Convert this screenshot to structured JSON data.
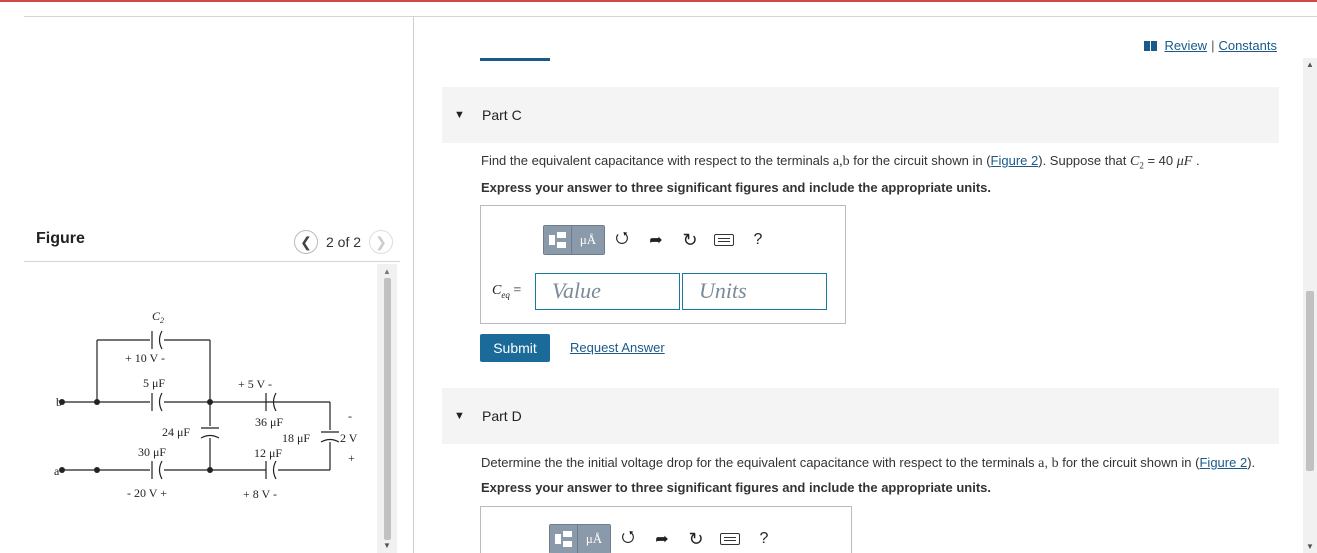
{
  "figure": {
    "title": "Figure",
    "counter": "2 of 2",
    "prev_icon": "chevron-left-icon",
    "next_icon": "chevron-right-icon",
    "circuit_labels": {
      "c2": "C",
      "c2_sub": "2",
      "v10": "+ 10 V  -",
      "c5": "5 μF",
      "v5": "+  5 V  -",
      "b": "b",
      "c24": "24 μF",
      "c36": "36 μF",
      "minus_right": "-",
      "c18": "18 μF",
      "v2": "2 V",
      "plus_right": "+",
      "c30": "30 μF",
      "c12": "12 μF",
      "a": "a",
      "v20": "-  20 V  +",
      "v8": "+  8 V  -"
    }
  },
  "header": {
    "review": "Review",
    "separator": "|",
    "constants": "Constants",
    "book_icon": "book-icon"
  },
  "part_c": {
    "label": "Part C",
    "prompt_pre": "Find the equivalent capacitance with respect to the terminals ",
    "prompt_terms": "a,b",
    "prompt_mid": " for the circuit shown in (",
    "prompt_link": "Figure 2",
    "prompt_post": "). Suppose that ",
    "prompt_var": "C",
    "prompt_var_sub": "2",
    "prompt_eq": " = 40 ",
    "prompt_unit": "μF",
    "prompt_end": " .",
    "instruction": "Express your answer to three significant figures and include the appropriate units.",
    "ceq_label": "C",
    "ceq_sub": "eq",
    "ceq_eq": " =",
    "value_placeholder": "Value",
    "units_placeholder": "Units",
    "submit": "Submit",
    "request_answer": "Request Answer"
  },
  "part_d": {
    "label": "Part D",
    "prompt_pre": "Determine the the initial voltage drop for the equivalent capacitance with respect to the terminals ",
    "prompt_a": "a",
    "prompt_comma": ", ",
    "prompt_b": "b",
    "prompt_mid": " for the circuit shown in (",
    "prompt_link": "Figure 2",
    "prompt_post": ").",
    "instruction": "Express your answer to three significant figures and include the appropriate units."
  },
  "toolbar": {
    "units_btn": "μÅ",
    "help": "?",
    "icons": [
      "templates-icon",
      "units-icon",
      "undo-icon",
      "redo-icon",
      "reset-icon",
      "keyboard-icon",
      "help-icon"
    ]
  }
}
